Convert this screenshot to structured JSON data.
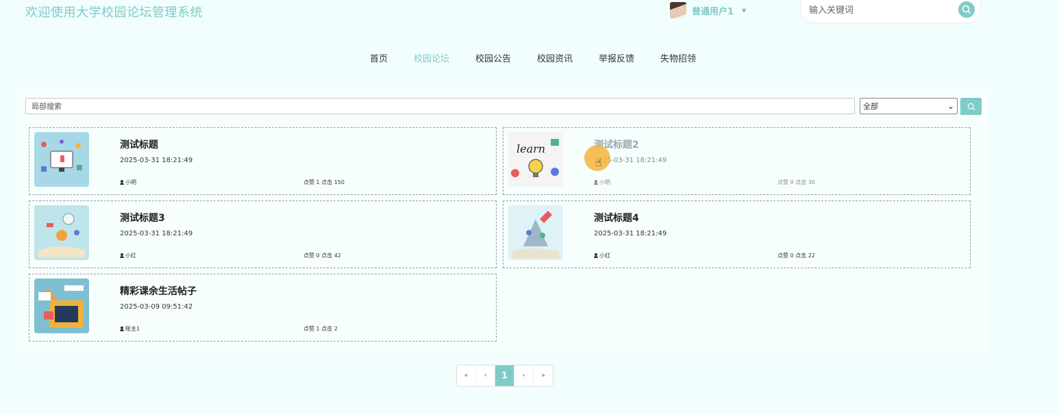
{
  "header": {
    "site_title": "欢迎使用大学校园论坛管理系统",
    "user_name": "普通用户1",
    "search_placeholder": "输入关键词"
  },
  "nav": {
    "items": [
      {
        "label": "首页",
        "active": false
      },
      {
        "label": "校园论坛",
        "active": true
      },
      {
        "label": "校园公告",
        "active": false
      },
      {
        "label": "校园资讯",
        "active": false
      },
      {
        "label": "举报反馈",
        "active": false
      },
      {
        "label": "失物招领",
        "active": false
      }
    ]
  },
  "filter": {
    "search_placeholder": "局部搜索",
    "select_value": "全部"
  },
  "posts": [
    {
      "title": "测试标题",
      "time": "2025-03-31 18:21:49",
      "author": "小明",
      "stats": "点赞 1 点击 150"
    },
    {
      "title": "测试标题2",
      "time": "2025-03-31 18:21:49",
      "author": "小明",
      "stats": "点赞 0 点击 30"
    },
    {
      "title": "测试标题3",
      "time": "2025-03-31 18:21:49",
      "author": "小红",
      "stats": "点赞 0 点击 42"
    },
    {
      "title": "测试标题4",
      "time": "2025-03-31 18:21:49",
      "author": "小红",
      "stats": "点赞 0 点击 22"
    },
    {
      "title": "精彩课余生活帖子",
      "time": "2025-03-09 09:51:42",
      "author": "账主1",
      "stats": "点赞 1 点击 2"
    }
  ],
  "pagination": {
    "first": "«",
    "prev": "‹",
    "current": "1",
    "next": "›",
    "last": "»"
  },
  "colors": {
    "accent": "#7ecbc8",
    "background": "#f2fdfd"
  }
}
